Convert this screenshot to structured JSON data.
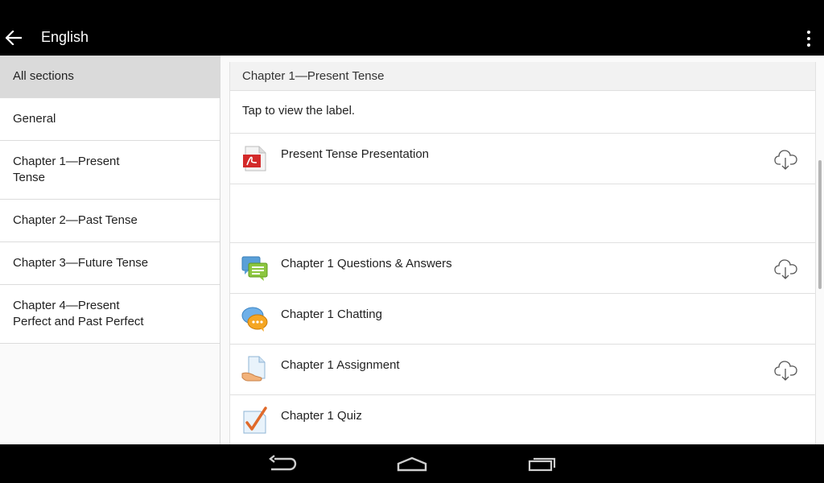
{
  "appbar": {
    "title": "English",
    "back_icon": "arrow-back-icon",
    "overflow_icon": "overflow-menu-icon"
  },
  "sidebar": {
    "items": [
      {
        "label": "All sections",
        "selected": true
      },
      {
        "label": "General"
      },
      {
        "label": "Chapter 1—Present Tense"
      },
      {
        "label": "Chapter 2—Past Tense"
      },
      {
        "label": "Chapter 3—Future Tense"
      },
      {
        "label": "Chapter 4—Present Perfect and Past Perfect"
      }
    ]
  },
  "section": {
    "title": "Chapter 1—Present Tense",
    "description": "Tap to view the label.",
    "activities": [
      {
        "name": "Present Tense Presentation",
        "icon": "pdf-icon",
        "download": true
      },
      {
        "name": "Chapter 1 Questions & Answers",
        "icon": "forum-icon",
        "download": true
      },
      {
        "name": "Chapter 1 Chatting",
        "icon": "chat-icon",
        "download": false
      },
      {
        "name": "Chapter 1 Assignment",
        "icon": "assignment-icon",
        "download": true
      },
      {
        "name": "Chapter 1 Quiz",
        "icon": "quiz-icon",
        "download": false
      }
    ]
  },
  "navbar": {
    "back_icon": "nav-back-icon",
    "home_icon": "nav-home-icon",
    "recents_icon": "nav-recents-icon"
  },
  "colors": {
    "appbar_bg": "#000000",
    "selected_bg": "#dadada",
    "pdf_red": "#d32a2a",
    "forum_green": "#7dbb2c",
    "chat_orange": "#f5a623",
    "quiz_check": "#e06a2a"
  }
}
